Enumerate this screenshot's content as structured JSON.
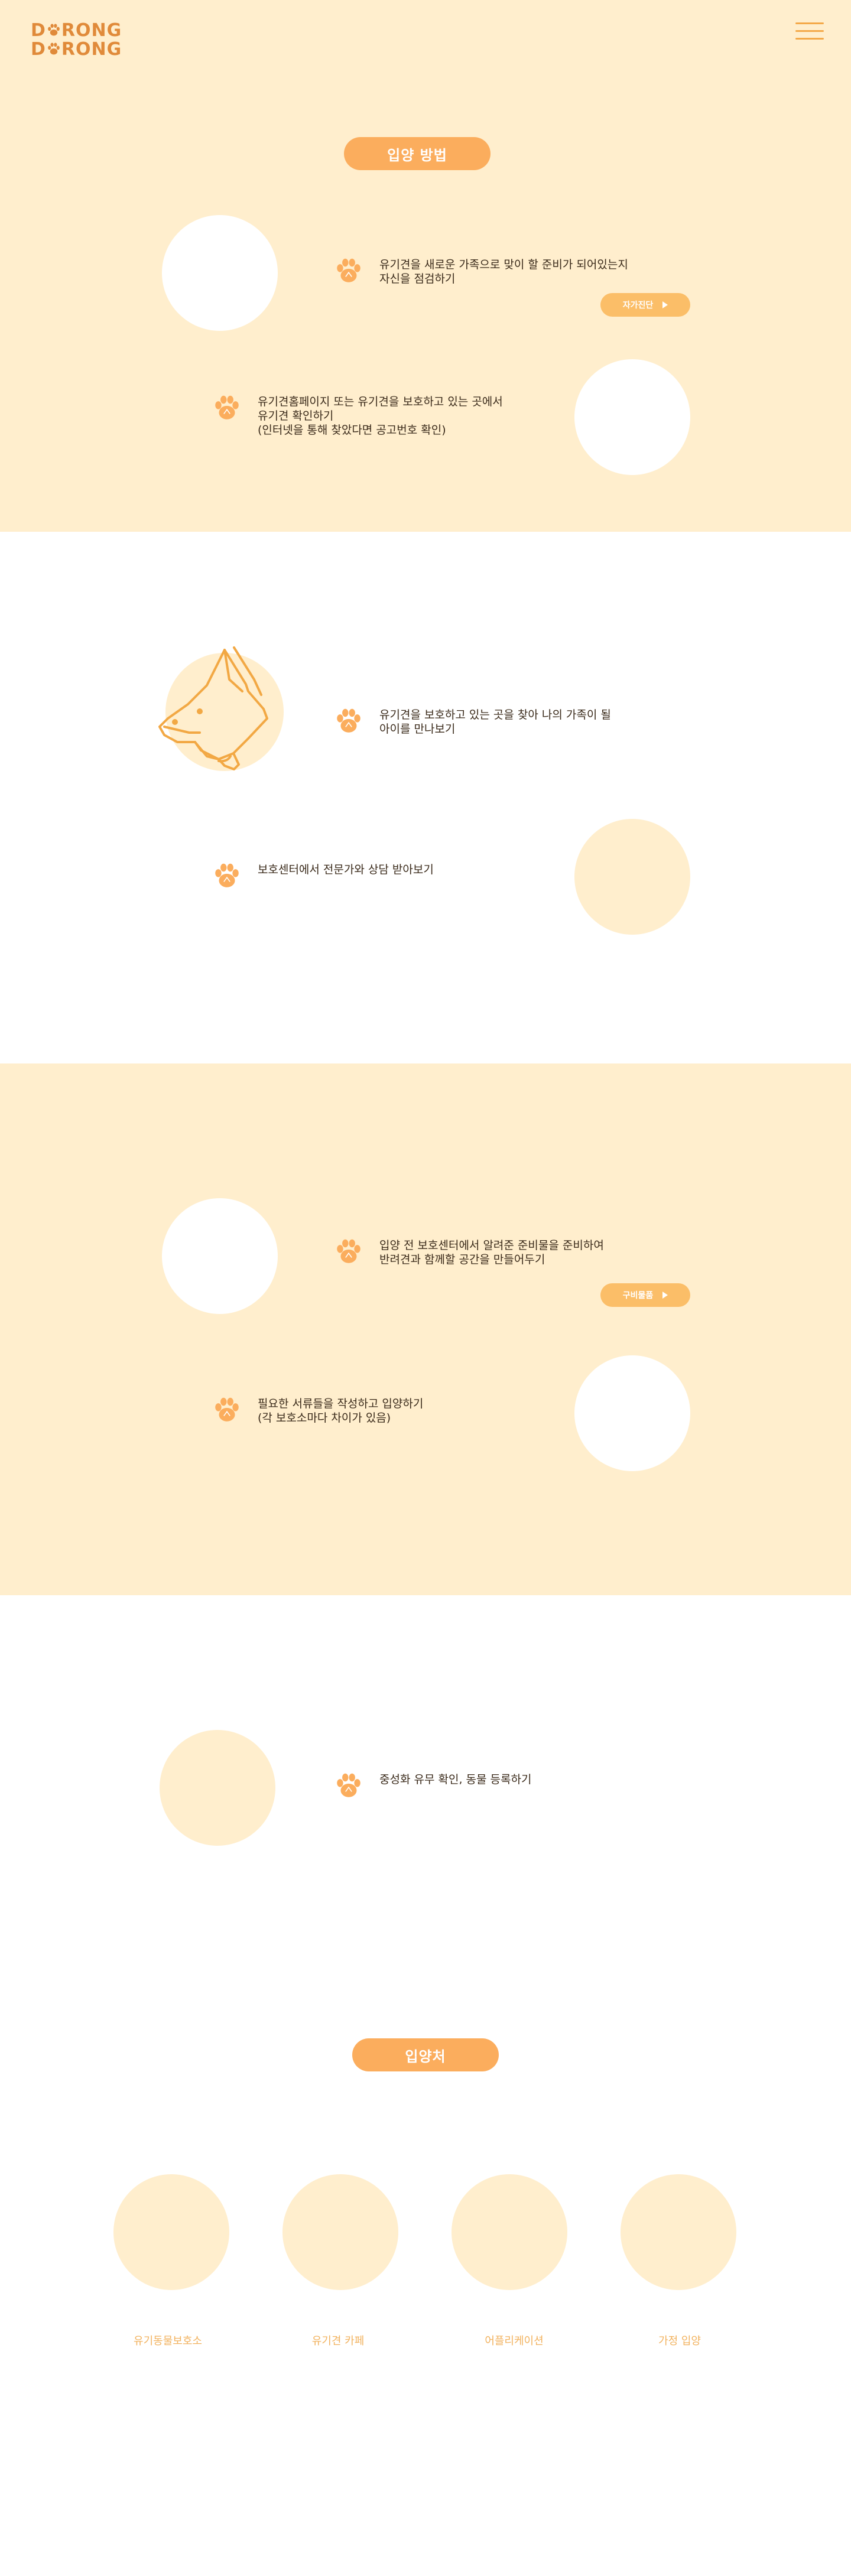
{
  "brand": {
    "logo_line1": "D🐾RONG",
    "logo_line2": "D🐾RONG",
    "logo_word1_pre": "D",
    "logo_word1_post": "RONG",
    "logo_word2_pre": "D",
    "logo_word2_post": "RONG",
    "accent_color": "#fbad5d",
    "cream_color": "#ffeecd"
  },
  "header": {
    "menu_icon": "hamburger-icon"
  },
  "method": {
    "title": "입양 방법",
    "steps": [
      {
        "text": "유기견을 새로운 가족으로 맞이 할 준비가 되어있는지\n자신을 점검하기",
        "icon": "paw-icon"
      },
      {
        "text": "유기견홈페이지 또는 유기견을 보호하고 있는 곳에서\n유기견 확인하기\n(인터넷을 통해 찾았다면 공고번호 확인)",
        "icon": "paw-icon"
      },
      {
        "text": "유기견을 보호하고 있는 곳을 찾아 나의 가족이 될\n아이를 만나보기",
        "icon": "paw-icon"
      },
      {
        "text": "보호센터에서 전문가와 상담 받아보기",
        "icon": "paw-icon"
      },
      {
        "text": "입양 전 보호센터에서 알려준 준비물을 준비하여\n반려견과 함께할 공간을 만들어두기",
        "icon": "paw-icon"
      },
      {
        "text": "필요한 서류들을 작성하고 입양하기\n(각 보호소마다 차이가 있음)",
        "icon": "paw-icon"
      },
      {
        "text": "중성화 유무 확인, 동물 등록하기",
        "icon": "paw-icon"
      }
    ],
    "self_check_button": "자가진단",
    "supplies_button": "구비물품"
  },
  "places": {
    "title": "입양처",
    "items": [
      {
        "label": "유기동물보호소"
      },
      {
        "label": "유기견 카페"
      },
      {
        "label": "어플리케이션"
      },
      {
        "label": "가정 입양"
      }
    ]
  }
}
